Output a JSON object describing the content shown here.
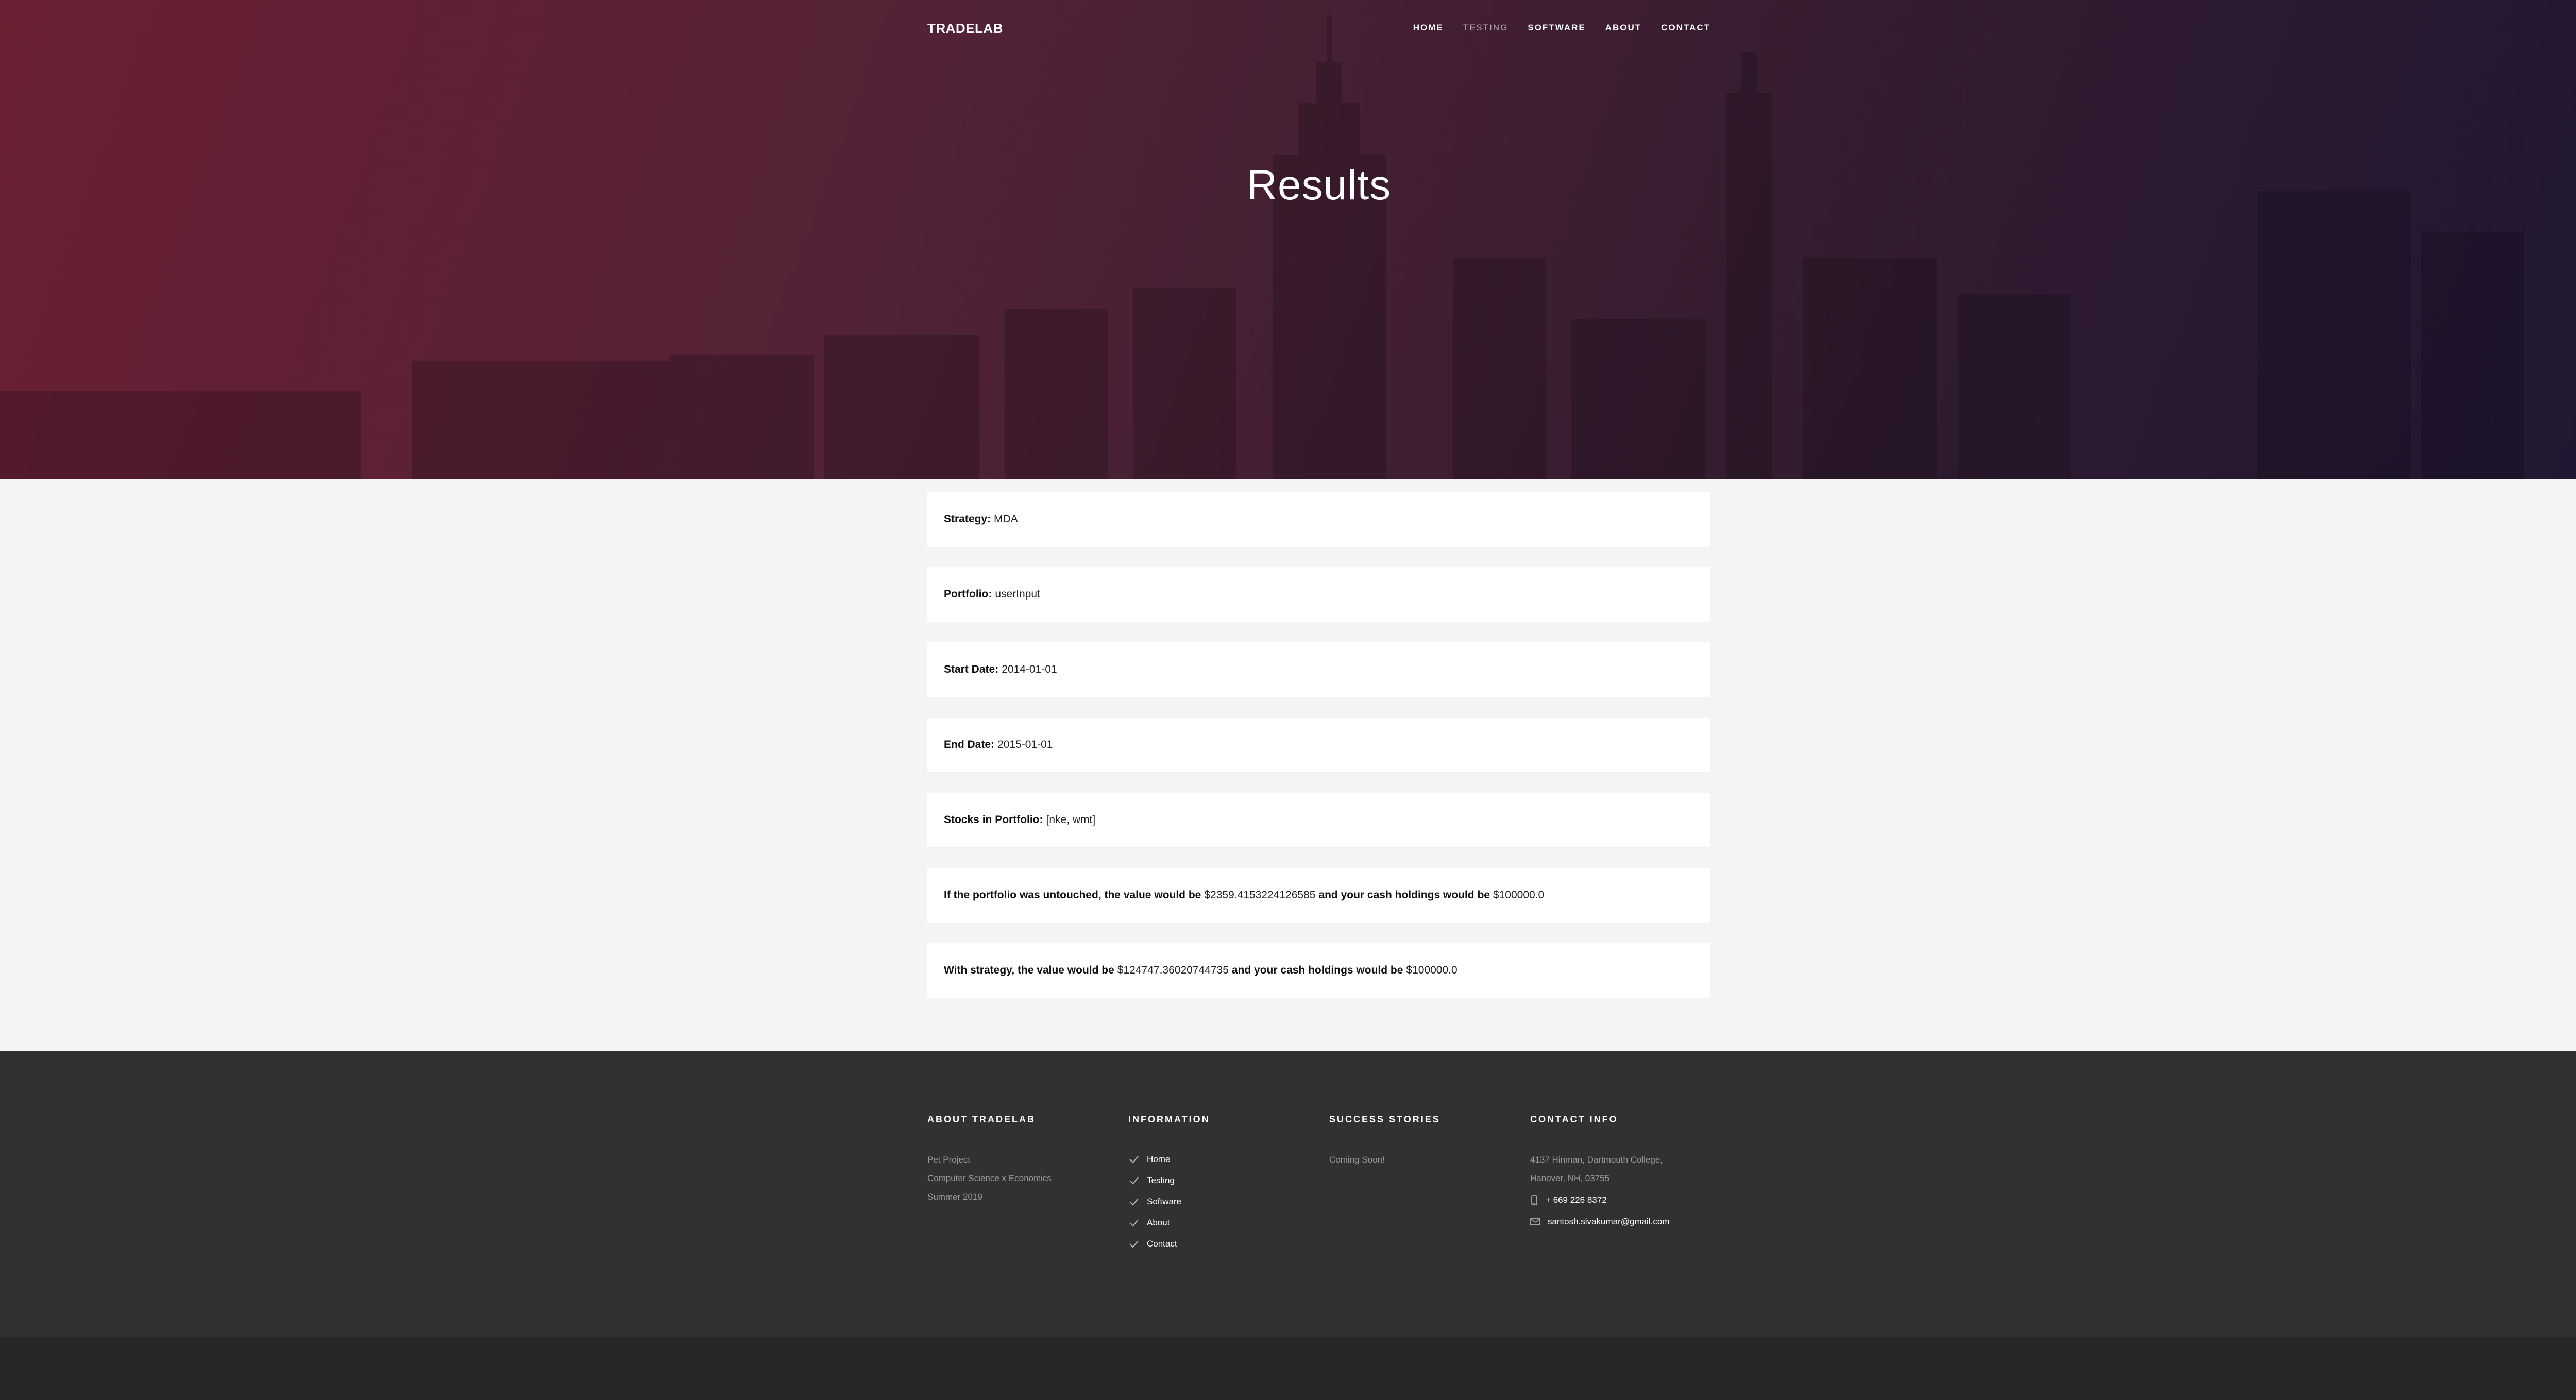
{
  "brand": "TRADELAB",
  "nav": [
    "HOME",
    "TESTING",
    "SOFTWARE",
    "ABOUT",
    "CONTACT"
  ],
  "nav_active": "TESTING",
  "hero_title": "Results",
  "results": {
    "strategy": {
      "label": "Strategy:",
      "value": "MDA"
    },
    "portfolio": {
      "label": "Portfolio:",
      "value": "userInput"
    },
    "start_date": {
      "label": "Start Date:",
      "value": "2014-01-01"
    },
    "end_date": {
      "label": "End Date:",
      "value": "2015-01-01"
    },
    "stocks": {
      "label": "Stocks in Portfolio:",
      "value": "[nke, wmt]"
    },
    "untouched": {
      "pre": "If the portfolio was untouched, the value would be",
      "value": "$2359.4153224126585",
      "mid": "and your cash holdings would be",
      "cash": "$100000.0"
    },
    "strategy_value": {
      "pre": "With strategy, the value would be",
      "value": "$124747.36020744735",
      "mid": "and your cash holdings would be",
      "cash": "$100000.0"
    }
  },
  "footer": {
    "about": {
      "heading": "ABOUT TRADELAB",
      "lines": [
        "Pet Project",
        "Computer Science x Economics",
        "Summer 2019"
      ]
    },
    "information": {
      "heading": "INFORMATION",
      "links": [
        "Home",
        "Testing",
        "Software",
        "About",
        "Contact"
      ]
    },
    "success": {
      "heading": "SUCCESS STORIES",
      "text": "Coming Soon!"
    },
    "contact": {
      "heading": "CONTACT INFO",
      "address_line1": "4137 Hinman, Dartmouth College,",
      "address_line2": "Hanover, NH, 03755",
      "phone": "+ 669 226 8372",
      "email": "santosh.sivakumar@gmail.com"
    }
  },
  "colors": {
    "hero_left": "#64142a",
    "hero_right": "#160e2a",
    "footer": "#303132",
    "footer_bottom": "#262626"
  },
  "icons": [
    "check-icon",
    "phone-icon",
    "mail-icon"
  ]
}
